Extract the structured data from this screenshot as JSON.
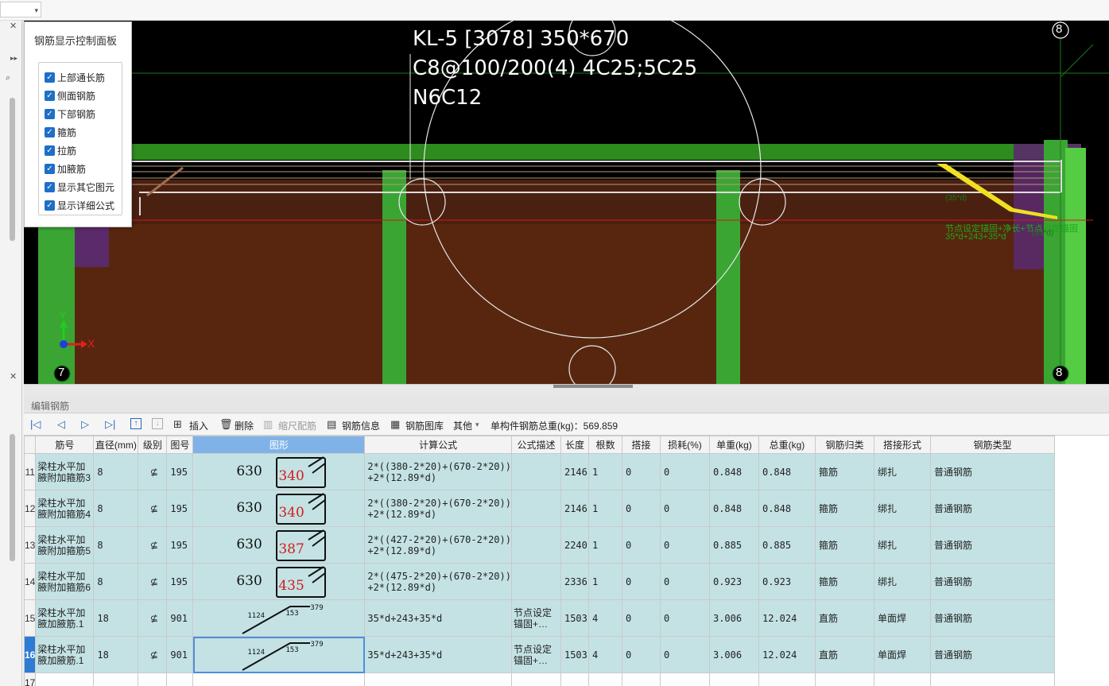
{
  "viewport": {
    "beam_label_lines": [
      "KL-5 [3078] 350*670",
      "C8@100/200(4) 4C25;5C25",
      "N6C12"
    ],
    "axis_left": "7",
    "axis_right": "8",
    "axis_top_right": "8",
    "axis_y": "Y",
    "axis_x": "X",
    "annot_line1": "节点设定锚固+净长+节点设定锚固",
    "annot_line2": "35*d+243+35*d",
    "annot_small1": "(35*d)",
    "annot_small2": "(35*d)",
    "colors": {
      "background": "#000000",
      "slab_green": "#2e8b1e",
      "beam_brown": "#58260e",
      "column_green": "#3aa533",
      "rebar": "#dcdcdc",
      "highlight_yellow": "#f0e020"
    }
  },
  "control_panel": {
    "title": "钢筋显示控制面板",
    "options": [
      {
        "label": "上部通长筋",
        "checked": true
      },
      {
        "label": "侧面钢筋",
        "checked": true
      },
      {
        "label": "下部钢筋",
        "checked": true
      },
      {
        "label": "箍筋",
        "checked": true
      },
      {
        "label": "拉筋",
        "checked": true
      },
      {
        "label": "加腋筋",
        "checked": true
      },
      {
        "label": "显示其它图元",
        "checked": true
      },
      {
        "label": "显示详细公式",
        "checked": true
      }
    ]
  },
  "editor": {
    "title": "编辑钢筋",
    "toolbar": {
      "insert": "插入",
      "delete": "删除",
      "scale_rebar": "缩尺配筋",
      "rebar_info": "钢筋信息",
      "rebar_library": "钢筋图库",
      "other": "其他",
      "total_weight": "单构件钢筋总重(kg)：569.859"
    },
    "columns": [
      "筋号",
      "直径(mm)",
      "级别",
      "图号",
      "图形",
      "计算公式",
      "公式描述",
      "长度",
      "根数",
      "搭接",
      "损耗(%)",
      "单重(kg)",
      "总重(kg)",
      "钢筋归类",
      "搭接形式",
      "钢筋类型"
    ],
    "rows": [
      {
        "num": "11",
        "name": "梁柱水平加腋附加箍筋3",
        "dia": "8",
        "grade": "⊈",
        "fig": "195",
        "shape_a": "630",
        "shape_b": "340",
        "formula": "2*((380-2*20)+(670-2*20))\n+2*(12.89*d)",
        "desc": "",
        "length": "2146",
        "count": "1",
        "lap": "0",
        "loss": "0",
        "unit_w": "0.848",
        "total_w": "0.848",
        "category": "箍筋",
        "lap_type": "绑扎",
        "type": "普通钢筋"
      },
      {
        "num": "12",
        "name": "梁柱水平加腋附加箍筋4",
        "dia": "8",
        "grade": "⊈",
        "fig": "195",
        "shape_a": "630",
        "shape_b": "340",
        "formula": "2*((380-2*20)+(670-2*20))\n+2*(12.89*d)",
        "desc": "",
        "length": "2146",
        "count": "1",
        "lap": "0",
        "loss": "0",
        "unit_w": "0.848",
        "total_w": "0.848",
        "category": "箍筋",
        "lap_type": "绑扎",
        "type": "普通钢筋"
      },
      {
        "num": "13",
        "name": "梁柱水平加腋附加箍筋5",
        "dia": "8",
        "grade": "⊈",
        "fig": "195",
        "shape_a": "630",
        "shape_b": "387",
        "formula": "2*((427-2*20)+(670-2*20))\n+2*(12.89*d)",
        "desc": "",
        "length": "2240",
        "count": "1",
        "lap": "0",
        "loss": "0",
        "unit_w": "0.885",
        "total_w": "0.885",
        "category": "箍筋",
        "lap_type": "绑扎",
        "type": "普通钢筋"
      },
      {
        "num": "14",
        "name": "梁柱水平加腋附加箍筋6",
        "dia": "8",
        "grade": "⊈",
        "fig": "195",
        "shape_a": "630",
        "shape_b": "435",
        "formula": "2*((475-2*20)+(670-2*20))\n+2*(12.89*d)",
        "desc": "",
        "length": "2336",
        "count": "1",
        "lap": "0",
        "loss": "0",
        "unit_w": "0.923",
        "total_w": "0.923",
        "category": "箍筋",
        "lap_type": "绑扎",
        "type": "普通钢筋"
      },
      {
        "num": "15",
        "name": "梁柱水平加腋加腋筋.1",
        "dia": "18",
        "grade": "⊈",
        "fig": "901",
        "shape_a": "1124",
        "shape_b": "153",
        "shape_c": "379",
        "formula": "35*d+243+35*d",
        "desc": "节点设定锚固+…",
        "length": "1503",
        "count": "4",
        "lap": "0",
        "loss": "0",
        "unit_w": "3.006",
        "total_w": "12.024",
        "category": "直筋",
        "lap_type": "单面焊",
        "type": "普通钢筋"
      },
      {
        "num": "16",
        "name": "梁柱水平加腋加腋筋.1",
        "dia": "18",
        "grade": "⊈",
        "fig": "901",
        "shape_a": "1124",
        "shape_b": "153",
        "shape_c": "379",
        "formula": "35*d+243+35*d",
        "desc": "节点设定锚固+…",
        "length": "1503",
        "count": "4",
        "lap": "0",
        "loss": "0",
        "unit_w": "3.006",
        "total_w": "12.024",
        "category": "直筋",
        "lap_type": "单面焊",
        "type": "普通钢筋"
      }
    ],
    "empty_row_num": "17"
  }
}
